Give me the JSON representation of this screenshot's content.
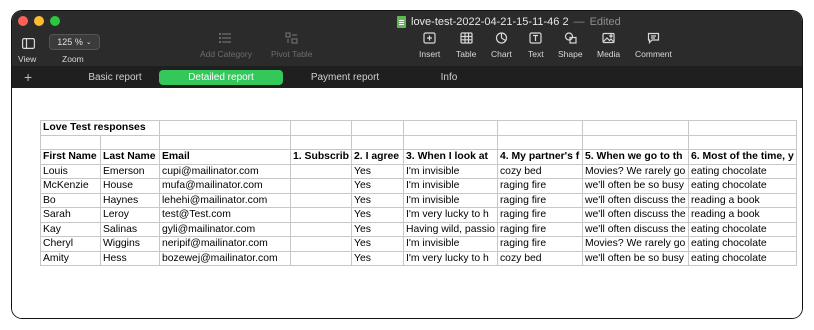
{
  "window": {
    "title": "love-test-2022-04-21-15-11-46 2",
    "title_separator": "—",
    "title_status": "Edited"
  },
  "toolbar": {
    "view_label": "View",
    "zoom_value": "125 %",
    "zoom_label": "Zoom",
    "add_category_label": "Add Category",
    "pivot_table_label": "Pivot Table",
    "insert_label": "Insert",
    "table_label": "Table",
    "chart_label": "Chart",
    "text_label": "Text",
    "shape_label": "Shape",
    "media_label": "Media",
    "comment_label": "Comment"
  },
  "tabs": {
    "add": "+",
    "items": [
      {
        "label": "Basic report",
        "active": false
      },
      {
        "label": "Detailed report",
        "active": true
      },
      {
        "label": "Payment report",
        "active": false
      },
      {
        "label": "Info",
        "active": false
      }
    ]
  },
  "colors": {
    "accent": "#34c759",
    "close": "#ff5f57",
    "minimize": "#febc2e",
    "maximize": "#28c840",
    "doc_icon": "#5fb854"
  },
  "sheet": {
    "table_title": "Love Test responses",
    "headers": [
      "First Name",
      "Last Name",
      "Email",
      "1. Subscrib",
      "2. I agree",
      "3. When I look at",
      "4. My partner's f",
      "5. When we go to th",
      "6. Most of the time, y"
    ],
    "rows": [
      [
        "Louis",
        "Emerson",
        "cupi@mailinator.com",
        "",
        "Yes",
        "I'm invisible",
        "cozy bed",
        "Movies? We rarely go",
        "eating chocolate"
      ],
      [
        "McKenzie",
        "House",
        "mufa@mailinator.com",
        "",
        "Yes",
        "I'm invisible",
        "raging fire",
        "we'll often be so busy",
        "eating chocolate"
      ],
      [
        "Bo",
        "Haynes",
        "lehehi@mailinator.com",
        "",
        "Yes",
        "I'm invisible",
        "raging fire",
        "we'll often discuss the",
        "reading a book"
      ],
      [
        "Sarah",
        "Leroy",
        "test@Test.com",
        "",
        "Yes",
        "I'm very lucky to h",
        "raging fire",
        "we'll often discuss the",
        "reading a book"
      ],
      [
        "Kay",
        "Salinas",
        "gyli@mailinator.com",
        "",
        "Yes",
        "Having wild, passio",
        "raging fire",
        "we'll often discuss the",
        "eating chocolate"
      ],
      [
        "Cheryl",
        "Wiggins",
        "neripif@mailinator.com",
        "",
        "Yes",
        "I'm invisible",
        "raging fire",
        "Movies? We rarely go",
        "eating chocolate"
      ],
      [
        "Amity",
        "Hess",
        "bozewej@mailinator.com",
        "",
        "Yes",
        "I'm very lucky to h",
        "cozy bed",
        "we'll often be so busy",
        "eating chocolate"
      ]
    ]
  }
}
